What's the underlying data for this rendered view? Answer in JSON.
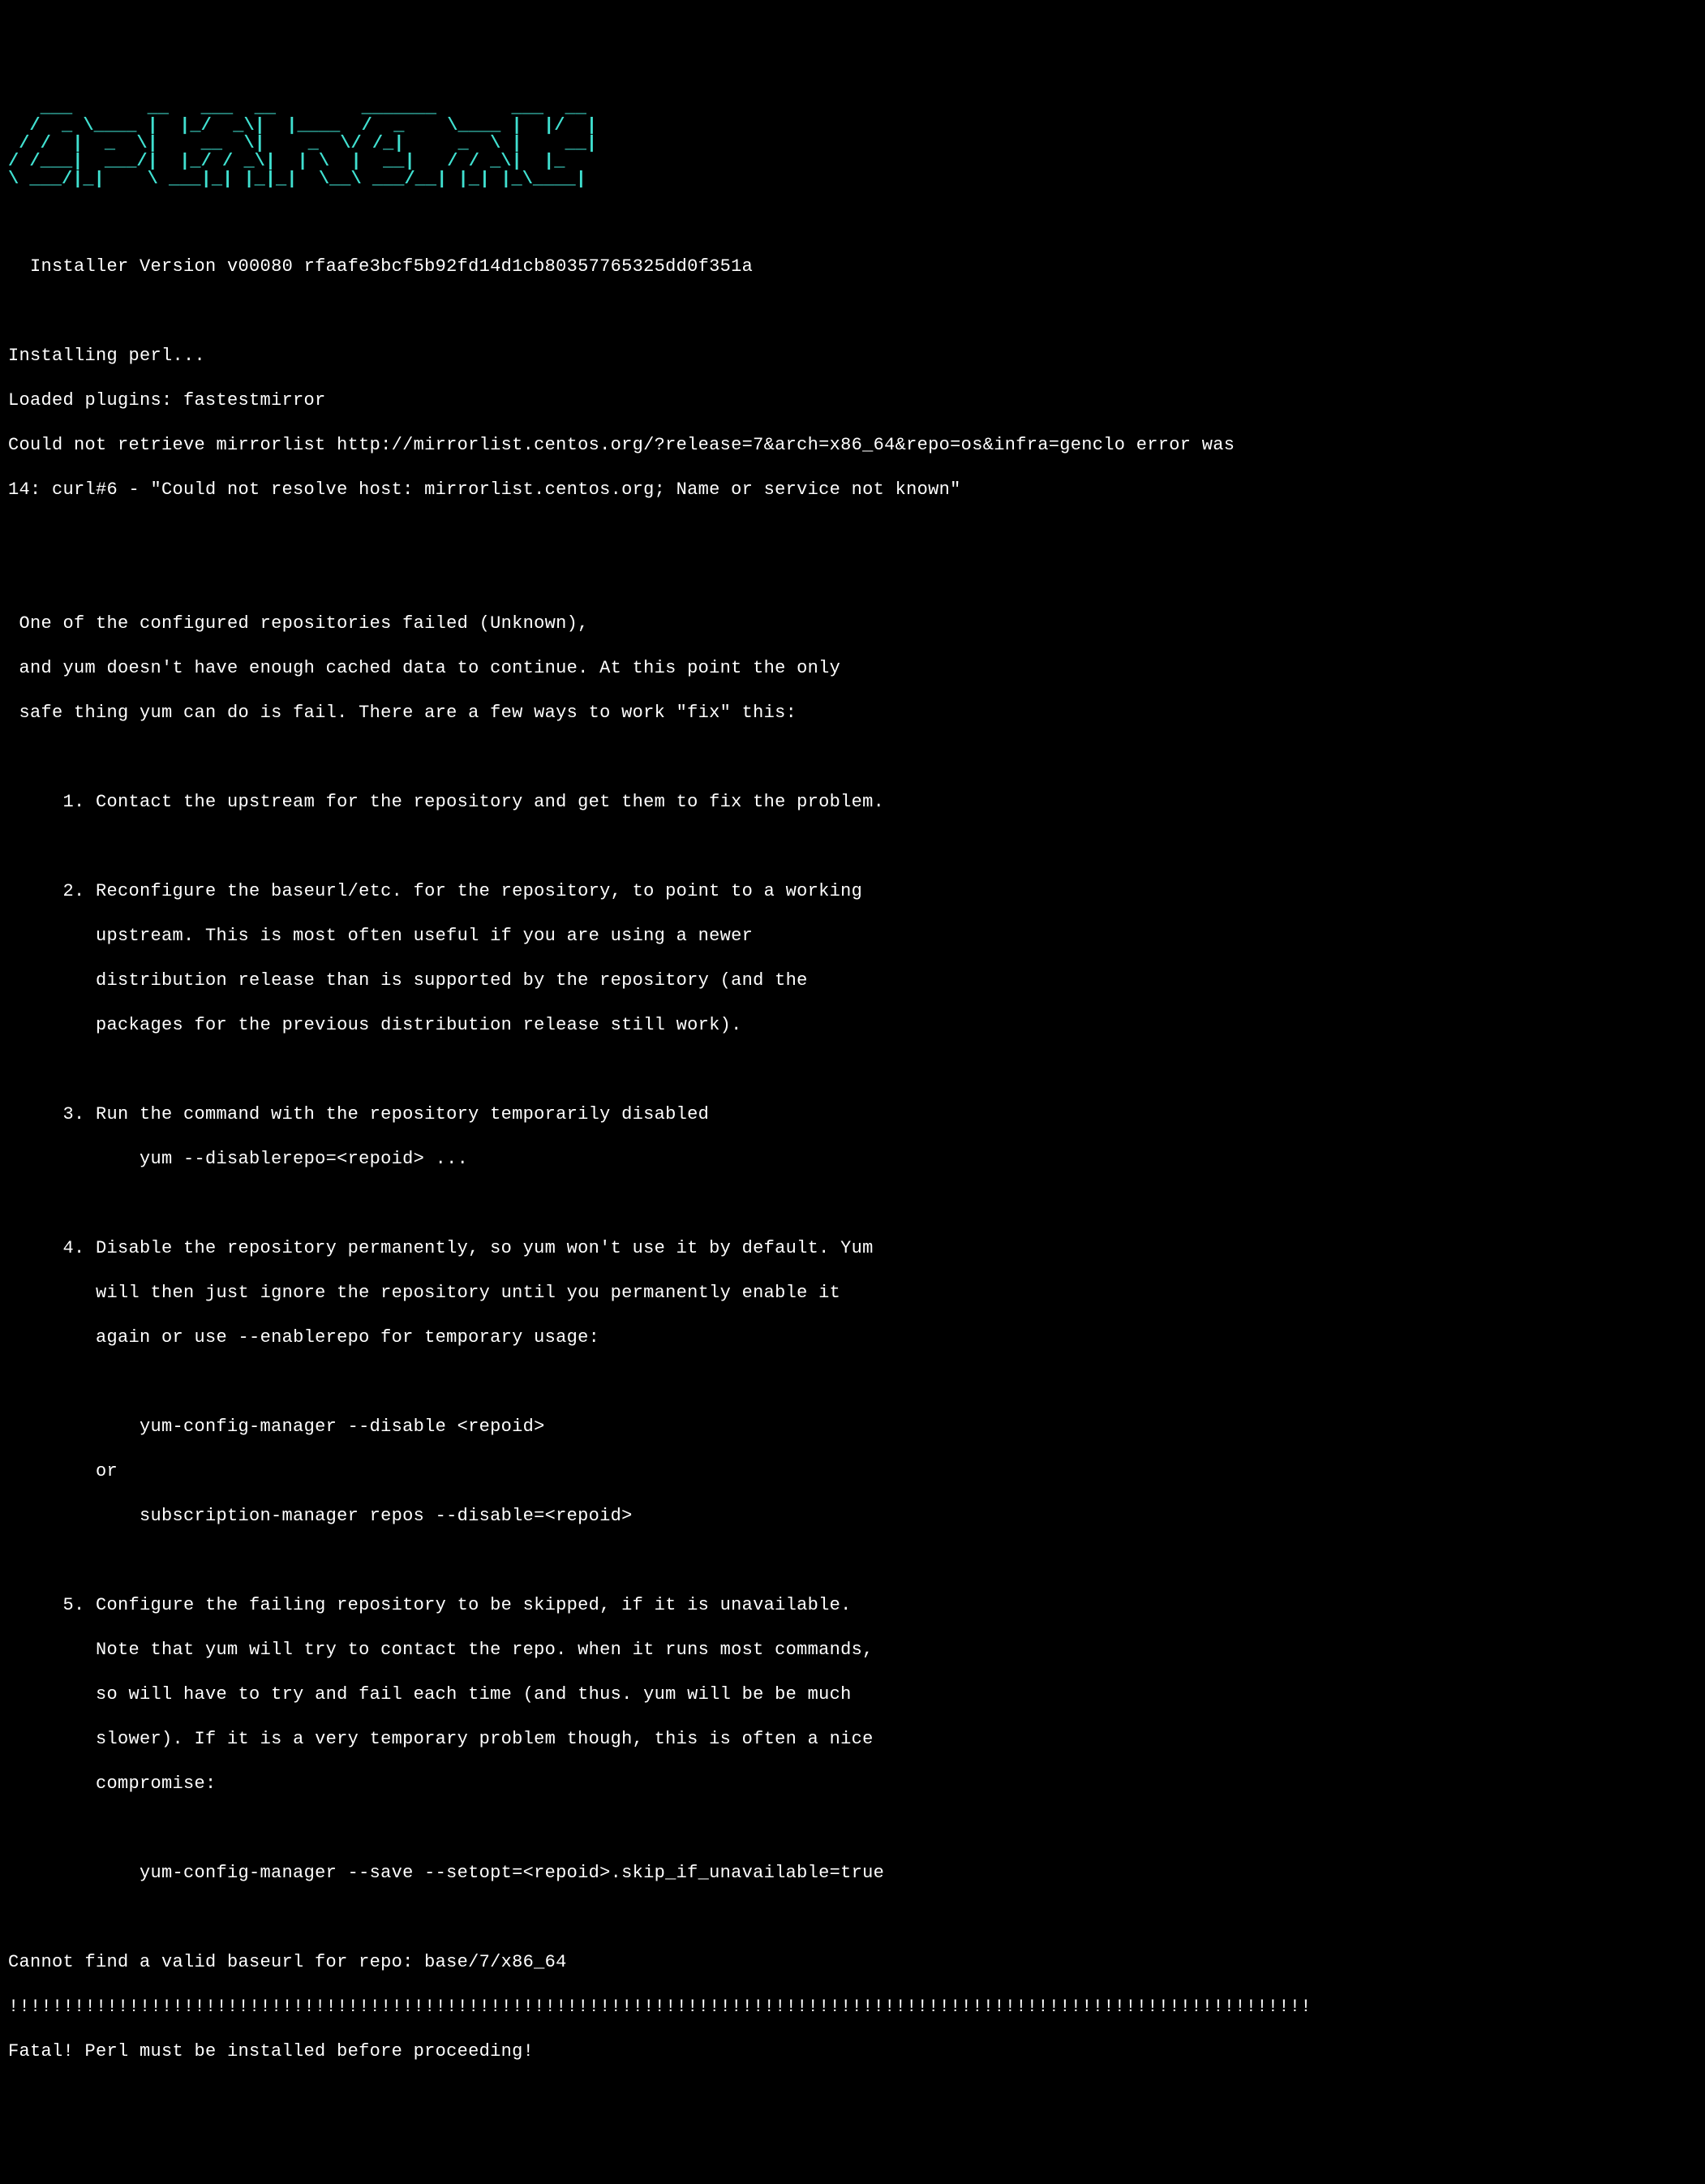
{
  "ascii_logo": "     ____                  _\n    / ___|_ __   __ _ _ __   ___| |\n   / /   | '_ \\ / _` | '_ \\ / _ \\ |\n  / /___ | |_) | (_| | | | |  __/ |\n  \\____/ | .__/ \\__,_|_| |_|\\___|_|\n         |_|",
  "installer_line": "  Installer Version v00080 rfaafe3bcf5b92fd14d1cb80357765325dd0f351a",
  "installing_perl": "Installing perl...",
  "loaded_plugins": "Loaded plugins: fastestmirror",
  "mirrorlist_error": "Could not retrieve mirrorlist http://mirrorlist.centos.org/?release=7&arch=x86_64&repo=os&infra=genclo error was",
  "curl_error": "14: curl#6 - \"Could not resolve host: mirrorlist.centos.org; Name or service not known\"",
  "repo_failed_1": " One of the configured repositories failed (Unknown),",
  "repo_failed_2": " and yum doesn't have enough cached data to continue. At this point the only",
  "repo_failed_3": " safe thing yum can do is fail. There are a few ways to work \"fix\" this:",
  "option1": "     1. Contact the upstream for the repository and get them to fix the problem.",
  "option2_1": "     2. Reconfigure the baseurl/etc. for the repository, to point to a working",
  "option2_2": "        upstream. This is most often useful if you are using a newer",
  "option2_3": "        distribution release than is supported by the repository (and the",
  "option2_4": "        packages for the previous distribution release still work).",
  "option3_1": "     3. Run the command with the repository temporarily disabled",
  "option3_2": "            yum --disablerepo=<repoid> ...",
  "option4_1": "     4. Disable the repository permanently, so yum won't use it by default. Yum",
  "option4_2": "        will then just ignore the repository until you permanently enable it",
  "option4_3": "        again or use --enablerepo for temporary usage:",
  "option4_4": "            yum-config-manager --disable <repoid>",
  "option4_5": "        or",
  "option4_6": "            subscription-manager repos --disable=<repoid>",
  "option5_1": "     5. Configure the failing repository to be skipped, if it is unavailable.",
  "option5_2": "        Note that yum will try to contact the repo. when it runs most commands,",
  "option5_3": "        so will have to try and fail each time (and thus. yum will be be much",
  "option5_4": "        slower). If it is a very temporary problem though, this is often a nice",
  "option5_5": "        compromise:",
  "option5_6": "            yum-config-manager --save --setopt=<repoid>.skip_if_unavailable=true",
  "cannot_find": "Cannot find a valid baseurl for repo: base/7/x86_64",
  "exclaim_line": "!!!!!!!!!!!!!!!!!!!!!!!!!!!!!!!!!!!!!!!!!!!!!!!!!!!!!!!!!!!!!!!!!!!!!!!!!!!!!!!!!!!!!!!!!!!!!!!!!!!!!!!!!!!!!!!!!!!!!!!",
  "fatal_line": "Fatal! Perl must be installed before proceeding!"
}
